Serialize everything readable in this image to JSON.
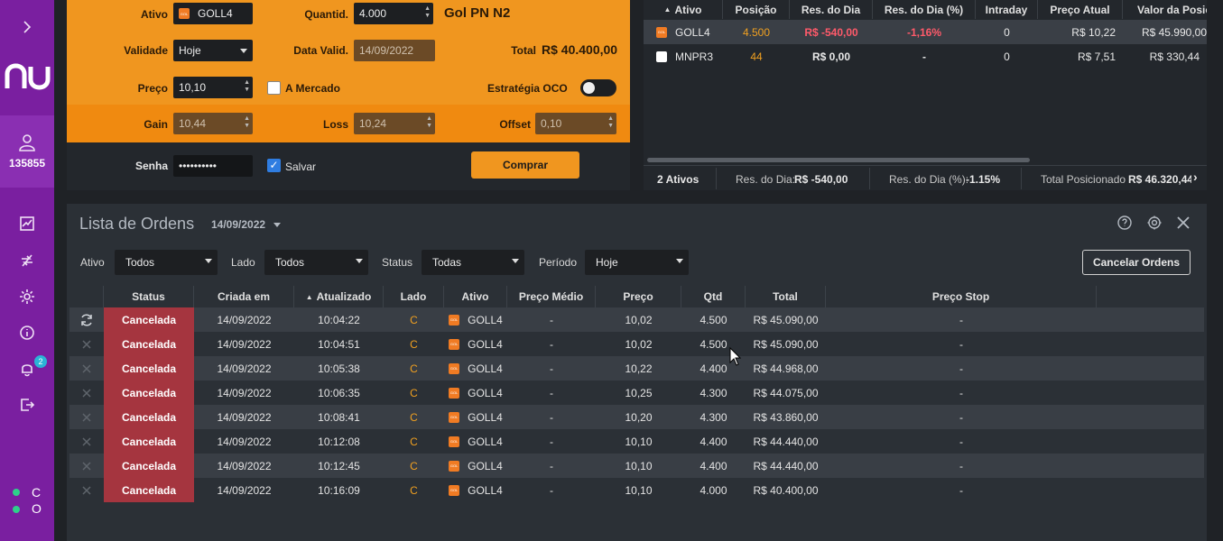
{
  "sidebar": {
    "logo": "nu",
    "account": "135855",
    "notif_count": "2",
    "status_letters": [
      "C",
      "O"
    ]
  },
  "order_form": {
    "ativo_label": "Ativo",
    "ativo_value": "GOLL4",
    "quantid_label": "Quantid.",
    "quantid_value": "4.000",
    "asset_name": "Gol PN N2",
    "validade_label": "Validade",
    "validade_value": "Hoje",
    "data_valid_label": "Data Valid.",
    "data_valid_value": "14/09/2022",
    "total_label": "Total",
    "total_value": "R$ 40.400,00",
    "preco_label": "Preço",
    "preco_value": "10,10",
    "mercado_label": "A Mercado",
    "oco_label": "Estratégia OCO",
    "gain_label": "Gain",
    "gain_value": "10,44",
    "loss_label": "Loss",
    "loss_value": "10,24",
    "offset_label": "Offset",
    "offset_value": "0,10",
    "senha_label": "Senha",
    "senha_value": "••••••••••",
    "salvar_label": "Salvar",
    "comprar_label": "Comprar"
  },
  "positions": {
    "headers": [
      "Ativo",
      "Posição",
      "Res. do Dia",
      "Res. do Dia (%)",
      "Intraday",
      "Preço Atual",
      "Valor da Posição"
    ],
    "rows": [
      {
        "ativo": "GOLL4",
        "posicao": "4.500",
        "res": "R$ -540,00",
        "res_pct": "-1,16%",
        "intraday": "0",
        "preco": "R$ 10,22",
        "valor": "R$ 45.990,00"
      },
      {
        "ativo": "MNPR3",
        "posicao": "44",
        "res": "R$ 0,00",
        "res_pct": "-",
        "intraday": "0",
        "preco": "R$ 7,51",
        "valor": "R$ 330,44"
      }
    ],
    "footer": {
      "ativos": "2 Ativos",
      "res_dia_label": "Res. do Dia:",
      "res_dia_value": "R$ -540,00",
      "res_pct_label": "Res. do Dia (%):",
      "res_pct_value": "-1.15%",
      "total_label": "Total Posicionado",
      "total_value": "R$ 46.320,44"
    }
  },
  "orders": {
    "title": "Lista de Ordens",
    "date": "14/09/2022",
    "filters": {
      "ativo_label": "Ativo",
      "ativo_value": "Todos",
      "lado_label": "Lado",
      "lado_value": "Todos",
      "status_label": "Status",
      "status_value": "Todas",
      "periodo_label": "Período",
      "periodo_value": "Hoje"
    },
    "cancel_label": "Cancelar Ordens",
    "headers": [
      "Status",
      "Criada em",
      "Atualizado",
      "Lado",
      "Ativo",
      "Preço Médio",
      "Preço",
      "Qtd",
      "Total",
      "Preço Stop"
    ],
    "rows": [
      {
        "status": "Cancelada",
        "criada": "14/09/2022",
        "atualizado": "10:04:22",
        "lado": "C",
        "ativo": "GOLL4",
        "preco_medio": "-",
        "preco": "10,02",
        "qtd": "4.500",
        "total": "R$ 45.090,00",
        "stop": "-"
      },
      {
        "status": "Cancelada",
        "criada": "14/09/2022",
        "atualizado": "10:04:51",
        "lado": "C",
        "ativo": "GOLL4",
        "preco_medio": "-",
        "preco": "10,02",
        "qtd": "4.500",
        "total": "R$ 45.090,00",
        "stop": "-"
      },
      {
        "status": "Cancelada",
        "criada": "14/09/2022",
        "atualizado": "10:05:38",
        "lado": "C",
        "ativo": "GOLL4",
        "preco_medio": "-",
        "preco": "10,22",
        "qtd": "4.400",
        "total": "R$ 44.968,00",
        "stop": "-"
      },
      {
        "status": "Cancelada",
        "criada": "14/09/2022",
        "atualizado": "10:06:35",
        "lado": "C",
        "ativo": "GOLL4",
        "preco_medio": "-",
        "preco": "10,25",
        "qtd": "4.300",
        "total": "R$ 44.075,00",
        "stop": "-"
      },
      {
        "status": "Cancelada",
        "criada": "14/09/2022",
        "atualizado": "10:08:41",
        "lado": "C",
        "ativo": "GOLL4",
        "preco_medio": "-",
        "preco": "10,20",
        "qtd": "4.300",
        "total": "R$ 43.860,00",
        "stop": "-"
      },
      {
        "status": "Cancelada",
        "criada": "14/09/2022",
        "atualizado": "10:12:08",
        "lado": "C",
        "ativo": "GOLL4",
        "preco_medio": "-",
        "preco": "10,10",
        "qtd": "4.400",
        "total": "R$ 44.440,00",
        "stop": "-"
      },
      {
        "status": "Cancelada",
        "criada": "14/09/2022",
        "atualizado": "10:12:45",
        "lado": "C",
        "ativo": "GOLL4",
        "preco_medio": "-",
        "preco": "10,10",
        "qtd": "4.400",
        "total": "R$ 44.440,00",
        "stop": "-"
      },
      {
        "status": "Cancelada",
        "criada": "14/09/2022",
        "atualizado": "10:16:09",
        "lado": "C",
        "ativo": "GOLL4",
        "preco_medio": "-",
        "preco": "10,10",
        "qtd": "4.000",
        "total": "R$ 40.400,00",
        "stop": "-"
      }
    ]
  },
  "icons": {
    "asset": "GOL"
  },
  "colors": {
    "accent": "#f0961f",
    "sidebar": "#7a1fa0",
    "cancelled": "#a5353f",
    "negative": "#ff5a6a",
    "position": "#f0a020"
  }
}
